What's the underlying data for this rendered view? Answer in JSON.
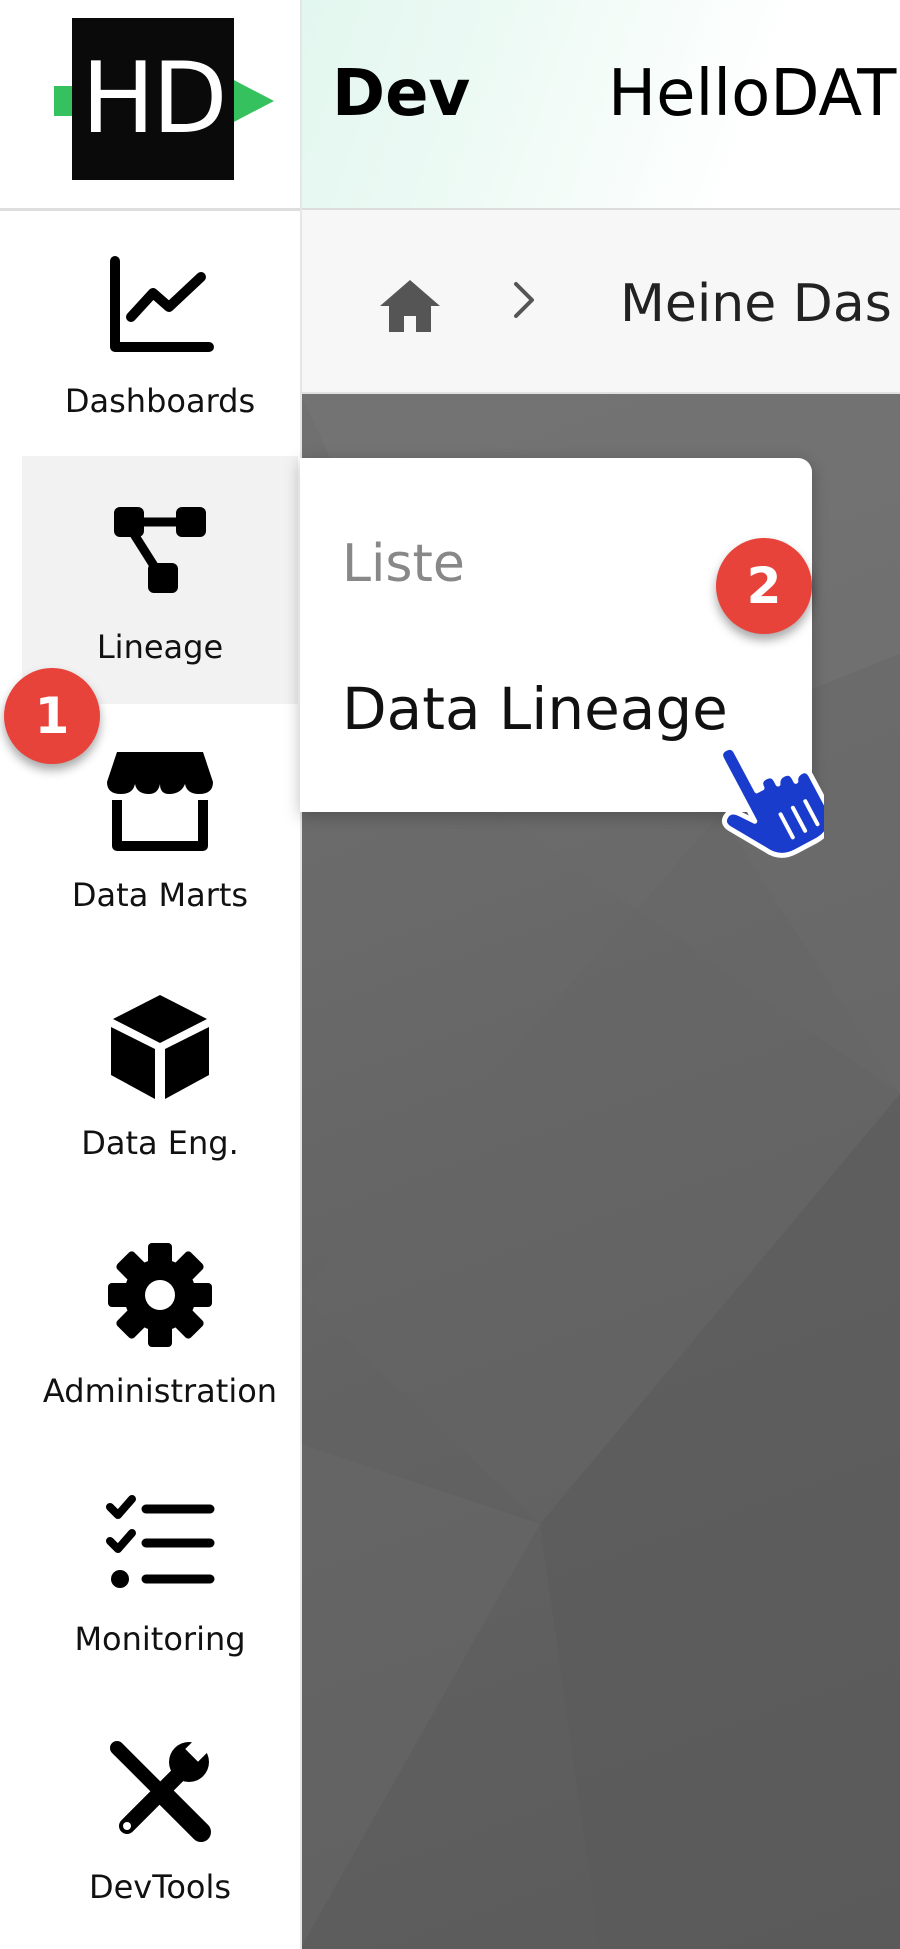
{
  "header": {
    "env_label": "Dev",
    "app_title": "HelloDAT"
  },
  "breadcrumb": {
    "current": "Meine Das"
  },
  "sidebar": {
    "logo_text": "HD",
    "items": [
      {
        "label": "Dashboards",
        "icon": "line-chart-icon"
      },
      {
        "label": "Lineage",
        "icon": "lineage-icon"
      },
      {
        "label": "Data Marts",
        "icon": "store-icon"
      },
      {
        "label": "Data Eng.",
        "icon": "cube-icon"
      },
      {
        "label": "Administration",
        "icon": "gear-icon"
      },
      {
        "label": "Monitoring",
        "icon": "checklist-icon"
      },
      {
        "label": "DevTools",
        "icon": "tools-icon"
      }
    ]
  },
  "flyout": {
    "header": "Liste",
    "item": "Data Lineage"
  },
  "badges": {
    "step1": "1",
    "step2": "2"
  },
  "colors": {
    "accent_green": "#35c25e",
    "badge_red": "#e8433a",
    "cursor_blue": "#1a3ccc"
  }
}
